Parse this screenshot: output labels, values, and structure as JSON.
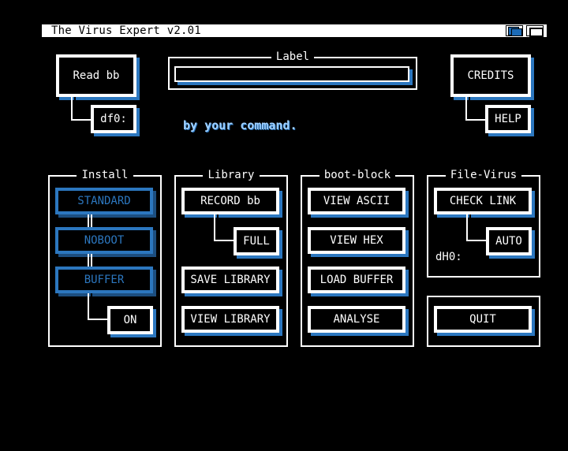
{
  "window": {
    "title": "The Virus Expert v2.01",
    "depth_icon": "depth-arrange-icon",
    "zoom_icon": "zoom-icon"
  },
  "top": {
    "read_bb": "Read bb",
    "drive": "df0:",
    "label_title": "Label",
    "label_value": "",
    "credits": "CREDITS",
    "help": "HELP",
    "status": "by your command."
  },
  "install": {
    "title": "Install",
    "standard": "STANDARD",
    "noboot": "NOBOOT",
    "buffer": "BUFFER",
    "on": "ON"
  },
  "library": {
    "title": "Library",
    "record_bb": "RECORD bb",
    "full": "FULL",
    "save": "SAVE LIBRARY",
    "view": "VIEW LIBRARY"
  },
  "bootblock": {
    "title": "boot-block",
    "view_ascii": "VIEW ASCII",
    "view_hex": "VIEW HEX",
    "load_buffer": "LOAD BUFFER",
    "analyse": "ANALYSE"
  },
  "filevirus": {
    "title": "File-Virus",
    "check_link": "CHECK LINK",
    "auto": "AUTO",
    "device": "dH0:"
  },
  "quit": "QUIT",
  "colors": {
    "background": "#000000",
    "foreground": "#ffffff",
    "accent": "#2c77bf"
  }
}
